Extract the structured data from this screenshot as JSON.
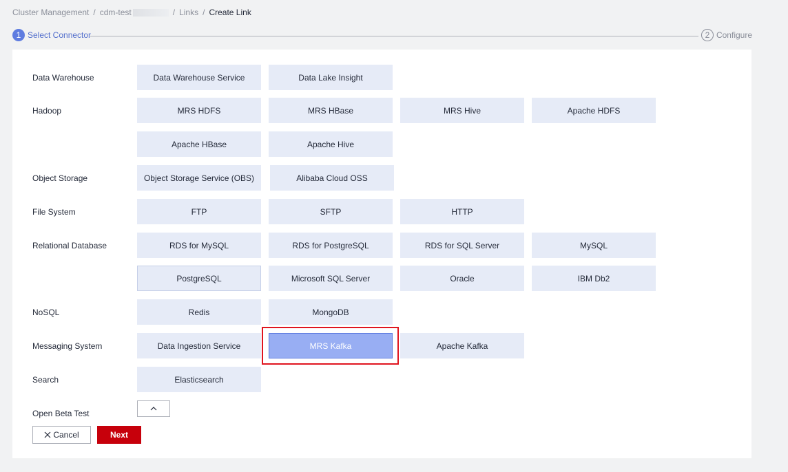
{
  "breadcrumb": {
    "items": [
      "Cluster Management",
      "cdm-test",
      "Links",
      "Create Link"
    ],
    "separator": "/"
  },
  "steps": [
    {
      "number": "1",
      "label": "Select Connector",
      "active": true
    },
    {
      "number": "2",
      "label": "Configure",
      "active": false
    }
  ],
  "categories": {
    "data_warehouse": "Data Warehouse",
    "hadoop": "Hadoop",
    "object_storage": "Object Storage",
    "file_system": "File System",
    "relational_database": "Relational Database",
    "nosql": "NoSQL",
    "messaging_system": "Messaging System",
    "search": "Search",
    "open_beta_test": "Open Beta Test"
  },
  "connectors": {
    "data_warehouse": [
      "Data Warehouse Service",
      "Data Lake Insight"
    ],
    "hadoop": [
      "MRS HDFS",
      "MRS HBase",
      "MRS Hive",
      "Apache HDFS",
      "Apache HBase",
      "Apache Hive"
    ],
    "object_storage": [
      "Object Storage Service (OBS)",
      "Alibaba Cloud OSS"
    ],
    "file_system": [
      "FTP",
      "SFTP",
      "HTTP"
    ],
    "relational_database": [
      "RDS for MySQL",
      "RDS for PostgreSQL",
      "RDS for SQL Server",
      "MySQL",
      "PostgreSQL",
      "Microsoft SQL Server",
      "Oracle",
      "IBM Db2"
    ],
    "nosql": [
      "Redis",
      "MongoDB"
    ],
    "messaging_system": [
      "Data Ingestion Service",
      "MRS Kafka",
      "Apache Kafka"
    ],
    "search": [
      "Elasticsearch"
    ]
  },
  "selected_connector": "MRS Kafka",
  "buttons": {
    "cancel": "Cancel",
    "next": "Next"
  },
  "colors": {
    "accent": "#5e7ce0",
    "tile_bg": "#e6ebf7",
    "selected_bg": "#98aef3",
    "next_button": "#c7000b",
    "highlight": "#e0141e"
  }
}
